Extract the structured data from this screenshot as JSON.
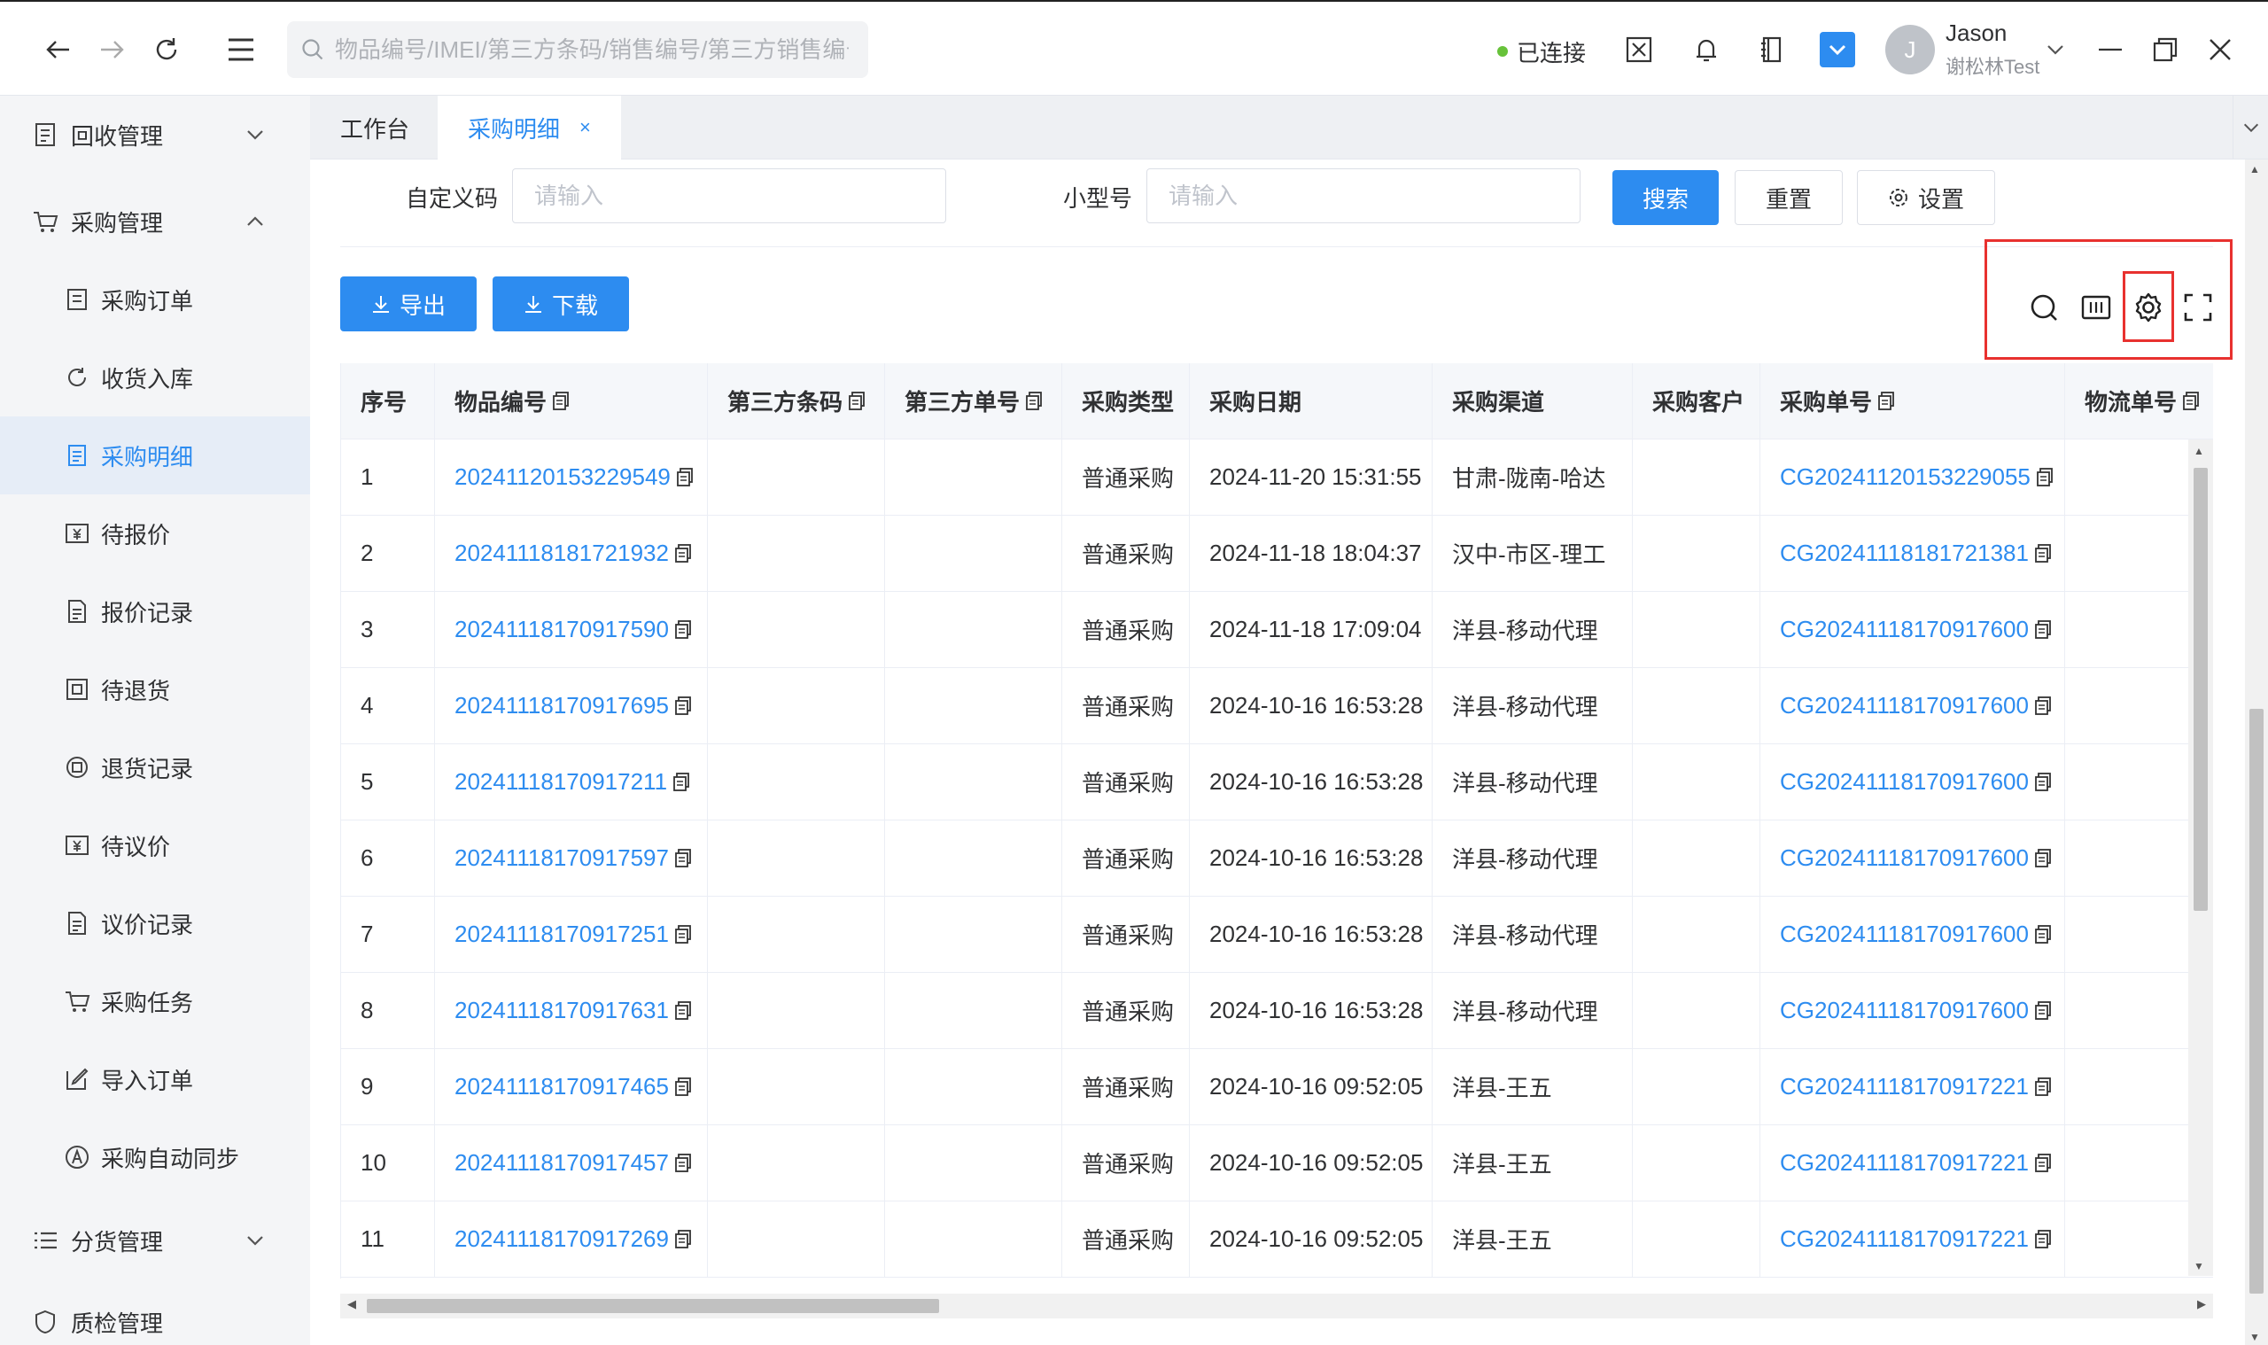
{
  "topbar": {
    "search_placeholder": "物品编号/IMEI/第三方条码/销售编号/第三方销售编号",
    "status": "已连接",
    "user_name": "Jason",
    "user_org": "谢松林Test",
    "avatar_letter": "J"
  },
  "sidebar": {
    "recycle": "回收管理",
    "purchase": "采购管理",
    "items": [
      {
        "label": "采购订单"
      },
      {
        "label": "收货入库"
      },
      {
        "label": "采购明细"
      },
      {
        "label": "待报价"
      },
      {
        "label": "报价记录"
      },
      {
        "label": "待退货"
      },
      {
        "label": "退货记录"
      },
      {
        "label": "待议价"
      },
      {
        "label": "议价记录"
      },
      {
        "label": "采购任务"
      },
      {
        "label": "导入订单"
      },
      {
        "label": "采购自动同步"
      }
    ],
    "distribution": "分货管理",
    "quality": "质检管理"
  },
  "tabs": {
    "workbench": "工作台",
    "detail": "采购明细",
    "close": "×"
  },
  "filters": {
    "custom_code_label": "自定义码",
    "custom_code_placeholder": "请输入",
    "model_label": "小型号",
    "model_placeholder": "请输入",
    "search_btn": "搜索",
    "reset_btn": "重置",
    "settings_btn": "设置"
  },
  "actions": {
    "export": "导出",
    "download": "下载"
  },
  "table": {
    "headers": [
      "序号",
      "物品编号",
      "第三方条码",
      "第三方单号",
      "采购类型",
      "采购日期",
      "采购渠道",
      "采购客户",
      "采购单号",
      "物流单号"
    ],
    "rows": [
      {
        "no": "1",
        "item": "20241120153229549",
        "type": "普通采购",
        "date": "2024-11-20 15:31:55",
        "channel": "甘肃-陇南-哈达",
        "order": "CG20241120153229055"
      },
      {
        "no": "2",
        "item": "20241118181721932",
        "type": "普通采购",
        "date": "2024-11-18 18:04:37",
        "channel": "汉中-市区-理工",
        "order": "CG20241118181721381"
      },
      {
        "no": "3",
        "item": "20241118170917590",
        "type": "普通采购",
        "date": "2024-11-18 17:09:04",
        "channel": "洋县-移动代理",
        "order": "CG20241118170917600"
      },
      {
        "no": "4",
        "item": "20241118170917695",
        "type": "普通采购",
        "date": "2024-10-16 16:53:28",
        "channel": "洋县-移动代理",
        "order": "CG20241118170917600"
      },
      {
        "no": "5",
        "item": "20241118170917211",
        "type": "普通采购",
        "date": "2024-10-16 16:53:28",
        "channel": "洋县-移动代理",
        "order": "CG20241118170917600"
      },
      {
        "no": "6",
        "item": "20241118170917597",
        "type": "普通采购",
        "date": "2024-10-16 16:53:28",
        "channel": "洋县-移动代理",
        "order": "CG20241118170917600"
      },
      {
        "no": "7",
        "item": "20241118170917251",
        "type": "普通采购",
        "date": "2024-10-16 16:53:28",
        "channel": "洋县-移动代理",
        "order": "CG20241118170917600"
      },
      {
        "no": "8",
        "item": "20241118170917631",
        "type": "普通采购",
        "date": "2024-10-16 16:53:28",
        "channel": "洋县-移动代理",
        "order": "CG20241118170917600"
      },
      {
        "no": "9",
        "item": "20241118170917465",
        "type": "普通采购",
        "date": "2024-10-16 09:52:05",
        "channel": "洋县-王五",
        "order": "CG20241118170917221"
      },
      {
        "no": "10",
        "item": "20241118170917457",
        "type": "普通采购",
        "date": "2024-10-16 09:52:05",
        "channel": "洋县-王五",
        "order": "CG20241118170917221"
      },
      {
        "no": "11",
        "item": "20241118170917269",
        "type": "普通采购",
        "date": "2024-10-16 09:52:05",
        "channel": "洋县-王五",
        "order": "CG20241118170917221"
      }
    ]
  },
  "colors": {
    "primary": "#2d8cf0",
    "highlight": "#e8312f",
    "connected": "#67c23a"
  }
}
